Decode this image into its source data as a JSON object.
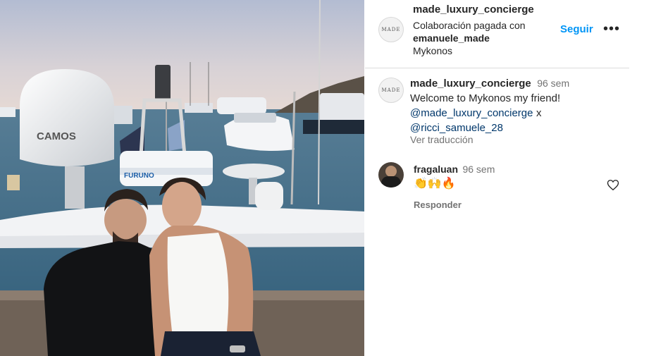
{
  "post_header": {
    "username": "made_luxury_concierge",
    "avatar_text": "MADE",
    "paid_partnership_line": "Colaboración pagada con",
    "partner_username": "emanuele_made",
    "location": "Mykonos",
    "follow_label": "Seguir",
    "more_label": "•••"
  },
  "caption": {
    "username": "made_luxury_concierge",
    "time": "96 sem",
    "text": "Welcome to Mykonos my friend!",
    "mention_1": "@made_luxury_concierge",
    "joiner": "x",
    "mention_2": "@ricci_samuele_28",
    "translate_label": "Ver traducción"
  },
  "comments": [
    {
      "username": "fragaluan",
      "time": "96 sem",
      "text": "👏🙌🔥",
      "reply_label": "Responder"
    }
  ],
  "photo": {
    "dome_brand": "CAMOS",
    "radar_brand": "FURUNO",
    "description_icons": [
      "yacht",
      "sea",
      "flag"
    ]
  },
  "colors": {
    "link": "#00376b",
    "follow": "#0095f6",
    "muted": "#737373",
    "text": "#262626"
  }
}
